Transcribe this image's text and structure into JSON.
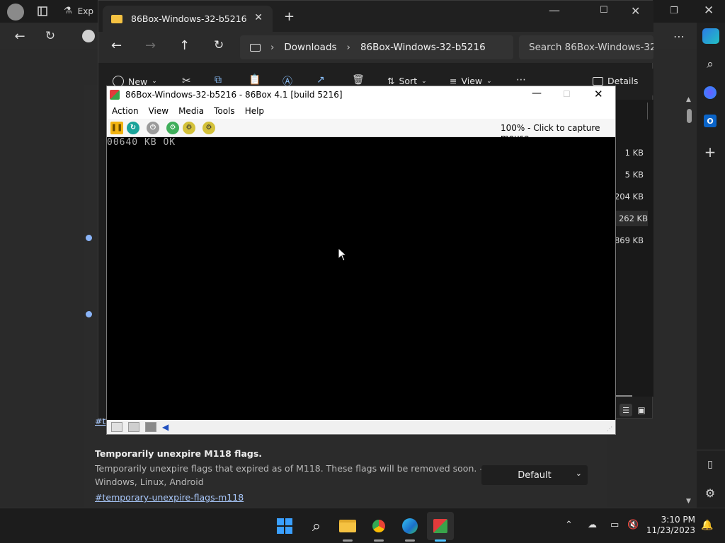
{
  "edge": {
    "tab_title": "Exp",
    "flag": {
      "title": "Temporarily unexpire M118 flags.",
      "desc_line1": "Temporarily unexpire flags that expired as of M118. These flags will be removed soon. – Mac,",
      "desc_line2": "Windows, Linux, Android",
      "link": "#temporary-unexpire-flags-m118",
      "select_value": "Default"
    },
    "partial_rows": [
      {
        "text": "#t"
      },
      {
        "text": "#t"
      }
    ]
  },
  "explorer": {
    "tab_title": "86Box-Windows-32-b5216",
    "new_tab": "+",
    "address": [
      "Downloads",
      "86Box-Windows-32-b5216"
    ],
    "search_placeholder": "Search 86Box-Windows-32-b5216",
    "commands": {
      "new": "New",
      "sort": "Sort",
      "view": "View",
      "details": "Details"
    },
    "sizes": [
      "1 KB",
      "5 KB",
      "204 KB",
      "262 KB",
      "869 KB"
    ]
  },
  "box86": {
    "title": "86Box-Windows-32-b5216 - 86Box 4.1 [build 5216]",
    "menu": [
      "Action",
      "View",
      "Media",
      "Tools",
      "Help"
    ],
    "status_text": "100% - Click to capture mouse",
    "screen_text": "00640 KB OK"
  },
  "taskbar": {
    "time": "3:10 PM",
    "date": "11/23/2023"
  },
  "colors": {
    "accent_blue": "#0078d4",
    "folder_yellow": "#f5c242",
    "link": "#a8c7fa"
  }
}
